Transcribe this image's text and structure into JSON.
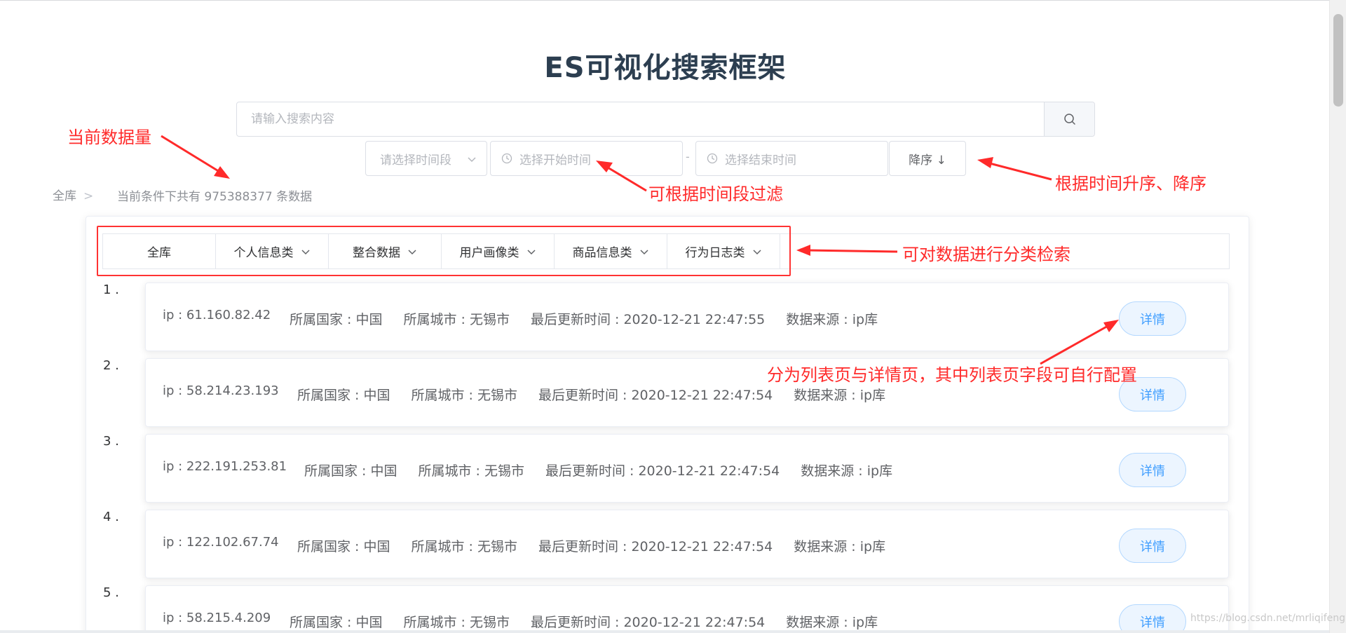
{
  "title": "ES可视化搜索框架",
  "search": {
    "placeholder": "请输入搜索内容"
  },
  "filters": {
    "period_placeholder": "请选择时间段",
    "start_placeholder": "选择开始时间",
    "range_separator": "-",
    "end_placeholder": "选择结束时间",
    "sort_label": "降序 ↓"
  },
  "breadcrumb": {
    "root": "全库",
    "separator": ">"
  },
  "count_text": "当前条件下共有 975388377 条数据",
  "categories": [
    {
      "label": "全库",
      "has_dropdown": false
    },
    {
      "label": "个人信息类",
      "has_dropdown": true
    },
    {
      "label": "整合数据",
      "has_dropdown": true
    },
    {
      "label": "用户画像类",
      "has_dropdown": true
    },
    {
      "label": "商品信息类",
      "has_dropdown": true
    },
    {
      "label": "行为日志类",
      "has_dropdown": true
    }
  ],
  "results": [
    {
      "index": "1 .",
      "ip": "ip : 61.160.82.42",
      "country": "所属国家 : 中国",
      "city": "所属城市 : 无锡市",
      "updated": "最后更新时间 : 2020-12-21 22:47:55",
      "source": "数据来源 : ip库",
      "detail_label": "详情"
    },
    {
      "index": "2 .",
      "ip": "ip : 58.214.23.193",
      "country": "所属国家 : 中国",
      "city": "所属城市 : 无锡市",
      "updated": "最后更新时间 : 2020-12-21 22:47:54",
      "source": "数据来源 : ip库",
      "detail_label": "详情"
    },
    {
      "index": "3 .",
      "ip": "ip : 222.191.253.81",
      "country": "所属国家 : 中国",
      "city": "所属城市 : 无锡市",
      "updated": "最后更新时间 : 2020-12-21 22:47:54",
      "source": "数据来源 : ip库",
      "detail_label": "详情"
    },
    {
      "index": "4 .",
      "ip": "ip : 122.102.67.74",
      "country": "所属国家 : 中国",
      "city": "所属城市 : 无锡市",
      "updated": "最后更新时间 : 2020-12-21 22:47:54",
      "source": "数据来源 : ip库",
      "detail_label": "详情"
    },
    {
      "index": "5 .",
      "ip": "ip : 58.215.4.209",
      "country": "所属国家 : 中国",
      "city": "所属城市 : 无锡市",
      "updated": "最后更新时间 : 2020-12-21 22:47:54",
      "source": "数据来源 : ip库",
      "detail_label": "详情"
    }
  ],
  "annotations": {
    "data_count": "当前数据量",
    "time_filter": "可根据时间段过滤",
    "time_sort": "根据时间升序、降序",
    "category_search": "可对数据进行分类检索",
    "list_detail": "分为列表页与详情页，其中列表页字段可自行配置"
  },
  "watermark": "https://blog.csdn.net/mrliqifeng",
  "colors": {
    "accent": "#409eff",
    "annotation": "#ff2a2a",
    "title": "#2c3e50"
  }
}
